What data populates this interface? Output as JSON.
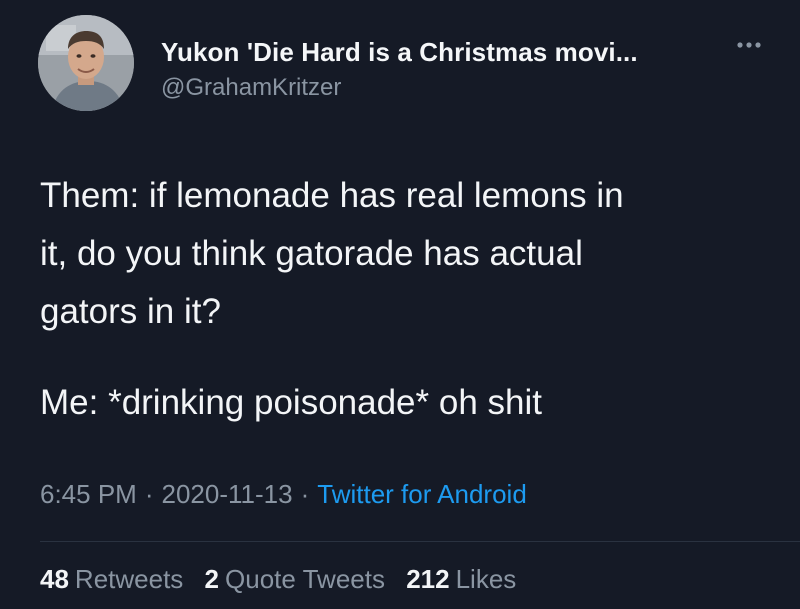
{
  "author": {
    "display_name": "Yukon 'Die Hard is a Christmas movi...",
    "handle": "@GrahamKritzer",
    "avatar_icon": "profile-photo"
  },
  "more_icon": "ellipsis-icon",
  "tweet": {
    "lines": [
      "Them: if lemonade has real lemons in",
      "it, do you think gatorade has actual",
      "gators in it?",
      "Me: *drinking poisonade* oh shit"
    ]
  },
  "meta": {
    "time": "6:45 PM",
    "separator": "·",
    "date": "2020-11-13",
    "source": "Twitter for Android"
  },
  "stats": {
    "retweets_count": "48",
    "retweets_label": "Retweets",
    "quotes_count": "2",
    "quotes_label": "Quote Tweets",
    "likes_count": "212",
    "likes_label": "Likes"
  },
  "colors": {
    "background": "#151a26",
    "text": "#f3f5f7",
    "muted": "#8a95a2",
    "link": "#1d9bf0"
  }
}
